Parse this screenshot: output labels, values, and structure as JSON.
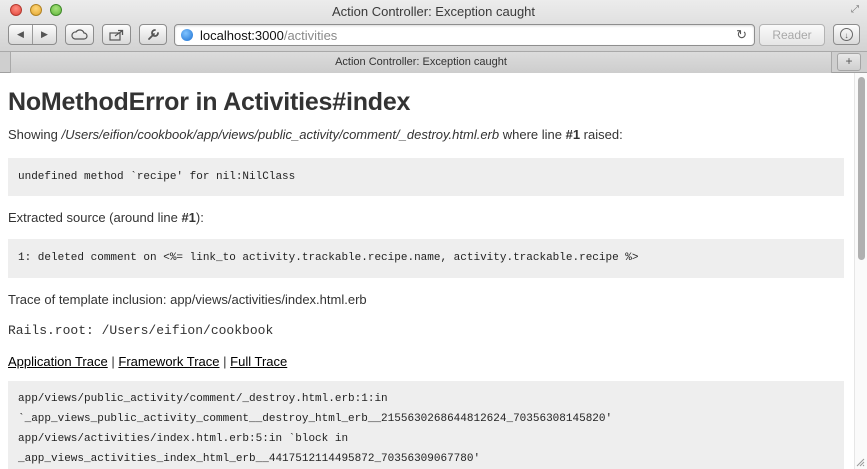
{
  "window": {
    "title": "Action Controller: Exception caught"
  },
  "toolbar": {
    "back_glyph": "◀",
    "forward_glyph": "▶",
    "cloud_icon": "cloud-icon",
    "share_icon": "share-icon",
    "wrench_icon": "wrench-icon",
    "url_host": "localhost:3000",
    "url_path": "/activities",
    "reload_glyph": "↻",
    "reader_label": "Reader",
    "download_glyph": "↓"
  },
  "tabs": [
    {
      "label": "Action Controller: Exception caught"
    }
  ],
  "new_tab_glyph": "+",
  "page": {
    "heading": "NoMethodError in Activities#index",
    "showing_prefix": "Showing ",
    "showing_path": "/Users/eifion/cookbook/app/views/public_activity/comment/_destroy.html.erb",
    "showing_middle": " where line ",
    "showing_line": "#1",
    "showing_suffix": " raised:",
    "error_message": "undefined method `recipe' for nil:NilClass",
    "extracted_prefix": "Extracted source (around line ",
    "extracted_line": "#1",
    "extracted_suffix": "):",
    "source_line": "1: deleted comment on <%= link_to activity.trackable.recipe.name, activity.trackable.recipe %>",
    "template_trace": "Trace of template inclusion: app/views/activities/index.html.erb",
    "rails_root": "Rails.root: /Users/eifion/cookbook",
    "trace_links": [
      "Application Trace",
      "Framework Trace",
      "Full Trace"
    ],
    "trace_separator": "|",
    "trace_lines": [
      "app/views/public_activity/comment/_destroy.html.erb:1:in",
      "`_app_views_public_activity_comment__destroy_html_erb__2155630268644812624_70356308145820'",
      "app/views/activities/index.html.erb:5:in `block in",
      "_app_views_activities_index_html_erb__4417512114495872_70356309067780'"
    ]
  }
}
